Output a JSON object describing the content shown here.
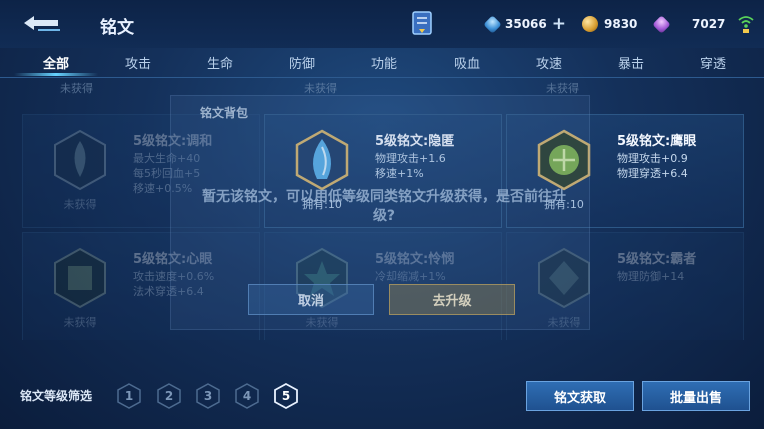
{
  "header": {
    "title": "铭文",
    "resources": {
      "gems": "35066",
      "gold": "9830",
      "crystals": "7027"
    }
  },
  "tabs": [
    {
      "label": "全部",
      "active": true
    },
    {
      "label": "攻击"
    },
    {
      "label": "生命"
    },
    {
      "label": "防御"
    },
    {
      "label": "功能"
    },
    {
      "label": "吸血"
    },
    {
      "label": "攻速"
    },
    {
      "label": "暴击"
    },
    {
      "label": "穿透"
    }
  ],
  "grid": {
    "peek_labels": [
      "未获得",
      "未获得",
      "未获得"
    ],
    "cards": [
      {
        "name": "5级铭文:调和",
        "stats": [
          "最大生命+40",
          "每5秒回血+5",
          "移速+0.5%"
        ],
        "count": "未获得",
        "owned": false,
        "color": "#7fa0a8"
      },
      {
        "name": "5级铭文:隐匿",
        "stats": [
          "物理攻击+1.6",
          "移速+1%"
        ],
        "count": "拥有:10",
        "owned": true,
        "color": "#5ab0e8"
      },
      {
        "name": "5级铭文:鹰眼",
        "stats": [
          "物理攻击+0.9",
          "物理穿透+6.4"
        ],
        "count": "拥有:10",
        "owned": true,
        "color": "#7fb34a"
      },
      {
        "name": "5级铭文:心眼",
        "stats": [
          "攻击速度+0.6%",
          "法术穿透+6.4"
        ],
        "count": "未获得",
        "owned": false,
        "color": "#7a9a6a"
      },
      {
        "name": "5级铭文:怜悯",
        "stats": [
          "冷却缩减+1%"
        ],
        "count": "未获得",
        "owned": false,
        "color": "#4fa87a"
      },
      {
        "name": "5级铭文:霸者",
        "stats": [
          "物理防御+14"
        ],
        "count": "未获得",
        "owned": false,
        "color": "#6a8a72"
      }
    ]
  },
  "dialog": {
    "title": "铭文背包",
    "message": "暂无该铭文，可以用低等级同类铭文升级获得，是否前往升级?",
    "cancel_label": "取消",
    "upgrade_label": "去升级"
  },
  "footer": {
    "filter_label": "铭文等级筛选",
    "levels": [
      "1",
      "2",
      "3",
      "4",
      "5"
    ],
    "active_level": "5",
    "obtain_label": "铭文获取",
    "sell_label": "批量出售"
  }
}
